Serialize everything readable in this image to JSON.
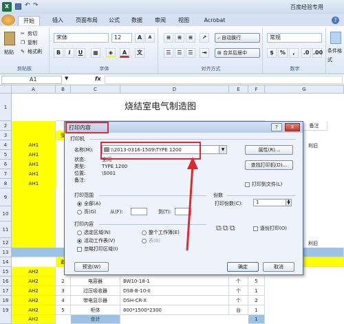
{
  "window": {
    "title": "百度经验专用"
  },
  "tabs": [
    "开始",
    "插入",
    "页面布局",
    "公式",
    "数据",
    "审阅",
    "视图",
    "Acrobat"
  ],
  "ribbon": {
    "paste": "粘贴",
    "cut": "剪切",
    "copy": "复制",
    "format_painter": "格式刷",
    "clipboard": "剪贴板",
    "font_name": "宋体",
    "font_size": "12",
    "font_group": "字体",
    "bold": "B",
    "italic": "I",
    "underline": "U",
    "wrap_text": "自动换行",
    "merge_center": "合并后居中",
    "alignment_group": "对齐方式",
    "number_format": "常规",
    "number_group": "数字",
    "cond_format": "条件格式"
  },
  "formula_bar": {
    "name_box": "A1",
    "fx": "fx",
    "content": ""
  },
  "grid": {
    "columns": [
      "A",
      "B",
      "C",
      "D",
      "E",
      "F",
      "G"
    ],
    "rows": [
      "1",
      "2",
      "3",
      "4",
      "5",
      "6",
      "7",
      "8",
      "9",
      "10",
      "11",
      "12",
      "13",
      "14",
      "15",
      "16",
      "17",
      "18",
      "19"
    ],
    "title": "烧结室电气制造图",
    "col_a": [
      "AH1",
      "AH1",
      "AH1",
      "AH1",
      "AH1",
      "AH2",
      "AH2",
      "AH2",
      "AH2",
      "AH2",
      "AH2"
    ],
    "row3_b": "受",
    "row14_b": "避",
    "col_g_a": "备注",
    "col_g_b": "利旧",
    "col_g_c": "利旧",
    "bottom_rows": [
      {
        "b": "2",
        "c": "电容器",
        "d": "BW10-18-1",
        "e": "个",
        "f": "5"
      },
      {
        "b": "3",
        "c": "过压吸收器",
        "d": "DSB-B-10-II",
        "e": "个",
        "f": "1"
      },
      {
        "b": "4",
        "c": "带电显示器",
        "d": "DSH-CR-X",
        "e": "个",
        "f": "2"
      },
      {
        "b": "5",
        "c": "柜体",
        "d": "800*1500*2300",
        "e": "台",
        "f": "1"
      },
      {
        "b": "",
        "c": "合计",
        "d": "",
        "e": "",
        "f": "1"
      }
    ]
  },
  "dialog": {
    "title": "打印内容",
    "help": "?",
    "close": "X",
    "printer_group": "打印机",
    "name_label": "名称(M):",
    "name_value": "\\\\2013-0316-1509\\TYPE 1200",
    "status_label": "状态:",
    "status_value": "空闲",
    "type_label": "类型:",
    "type_value": "TYPE 1200",
    "location_label": "位置:",
    "location_value": "\\S001",
    "comment_label": "备注:",
    "comment_value": "",
    "properties_button": "属性(R)...",
    "find_printer_button": "查找打印机(D)...",
    "print_to_file": "打印到文件(L)",
    "range_group": "打印范围",
    "all_pages": "全部(A)",
    "pages": "页(G)",
    "from": "从(F):",
    "to": "到(T):",
    "copies_group": "份数",
    "copies_label": "打印份数(C):",
    "copies_value": "1",
    "content_group": "打印内容",
    "selection": "选定区域(N)",
    "entire_workbook": "整个工作簿(E)",
    "active_sheets": "活动工作表(V)",
    "table": "表(B)",
    "ignore_print_areas": "忽略打印区域(I)",
    "collate": "逐份打印(O)",
    "preview_button": "预览(W)",
    "ok_button": "确定",
    "cancel_button": "取消"
  },
  "colors": {
    "highlight": "#e0272d",
    "yellow_fill": "#ffff00",
    "blue_fill": "#9cc2e5"
  }
}
